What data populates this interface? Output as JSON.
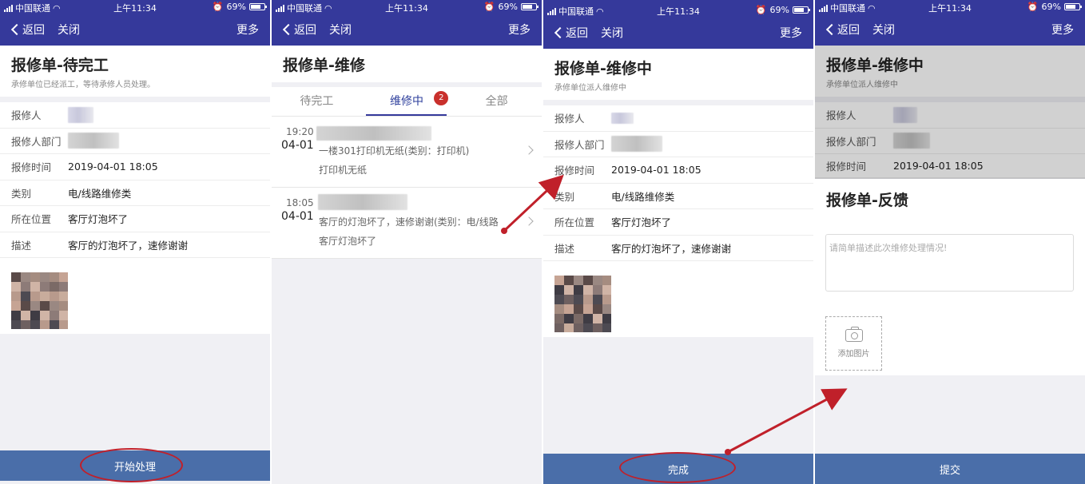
{
  "status_bar": {
    "carrier": "中国联通",
    "time_a": "上午11:34",
    "time_b": "上午11:34",
    "time_c": "上午11:34",
    "time_d": "上午11:34",
    "battery": "69%",
    "battery_level": 0.69
  },
  "nav": {
    "back": "返回",
    "close": "关闭",
    "more": "更多"
  },
  "screen1": {
    "title": "报修单-待完工",
    "subtitle": "承修单位已经派工，等待承修人员处理。",
    "fields": {
      "reporter_label": "报修人",
      "dept_label": "报修人部门",
      "time_label": "报修时间",
      "time_value": "2019-04-01 18:05",
      "category_label": "类别",
      "category_value": "电/线路维修类",
      "location_label": "所在位置",
      "location_value": "客厅灯泡坏了",
      "desc_label": "描述",
      "desc_value": "客厅的灯泡坏了，速修谢谢"
    },
    "action": "开始处理"
  },
  "screen2": {
    "title": "报修单-维修",
    "tabs": [
      "待完工",
      "维修中",
      "全部"
    ],
    "active_tab": "维修中",
    "badge": "2",
    "items": [
      {
        "time": "19:20",
        "date": "04-01",
        "line1": "一楼301打印机无纸(类别：打印机)",
        "line2": "打印机无纸"
      },
      {
        "time": "18:05",
        "date": "04-01",
        "line1": "客厅的灯泡坏了，速修谢谢(类别：电/线路",
        "line2": "客厅灯泡坏了"
      }
    ]
  },
  "screen3": {
    "title": "报修单-维修中",
    "subtitle": "承修单位派人维修中",
    "fields": {
      "reporter_label": "报修人",
      "dept_label": "报修人部门",
      "time_label": "报修时间",
      "time_value": "2019-04-01 18:05",
      "category_label": "类别",
      "category_value": "电/线路维修类",
      "location_label": "所在位置",
      "location_value": "客厅灯泡坏了",
      "desc_label": "描述",
      "desc_value": "客厅的灯泡坏了，速修谢谢"
    },
    "action": "完成"
  },
  "screen4": {
    "title": "报修单-维修中",
    "subtitle": "承修单位派人维修中",
    "fields": {
      "reporter_label": "报修人",
      "dept_label": "报修人部门",
      "time_label": "报修时间",
      "time_value": "2019-04-01 18:05"
    },
    "feedback_title": "报修单-反馈",
    "placeholder": "请简单描述此次维修处理情况!",
    "add_photo": "添加图片",
    "action": "提交"
  },
  "colors": {
    "nav_bg": "#35399b",
    "bottom_bar": "#4a6ea9",
    "highlight": "#c0202a",
    "badge": "#c9302c"
  }
}
